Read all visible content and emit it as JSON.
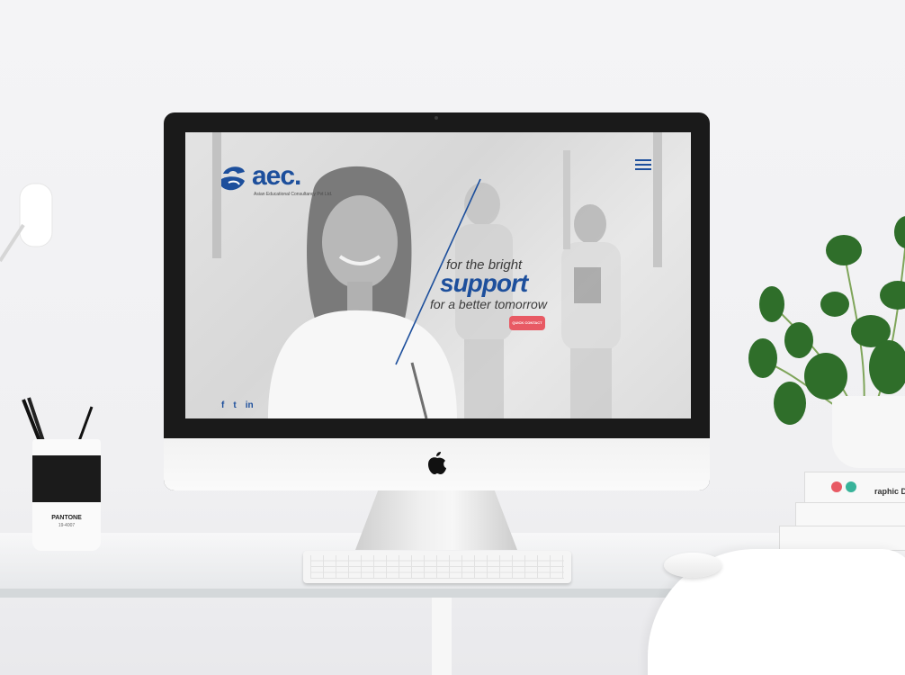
{
  "website": {
    "logo": {
      "brand": "aec.",
      "tagline": "Asian Educational Consultancy Pvt Ltd."
    },
    "hero": {
      "line1": "for the bright",
      "line2": "support",
      "line3": "for a better tomorrow",
      "cta_label": "QUICK CONTACT"
    },
    "social": {
      "facebook": "f",
      "twitter": "t",
      "linkedin": "in"
    },
    "colors": {
      "brand_blue": "#1d4f9c",
      "cta_red": "#e85a64"
    }
  },
  "props": {
    "cup_brand": "PANTONE",
    "cup_code": "19-4007",
    "book_title": "raphic D"
  },
  "icons": {
    "menu": "hamburger-icon",
    "apple": "apple-logo-icon",
    "facebook": "facebook-icon",
    "twitter": "twitter-icon",
    "linkedin": "linkedin-icon"
  }
}
